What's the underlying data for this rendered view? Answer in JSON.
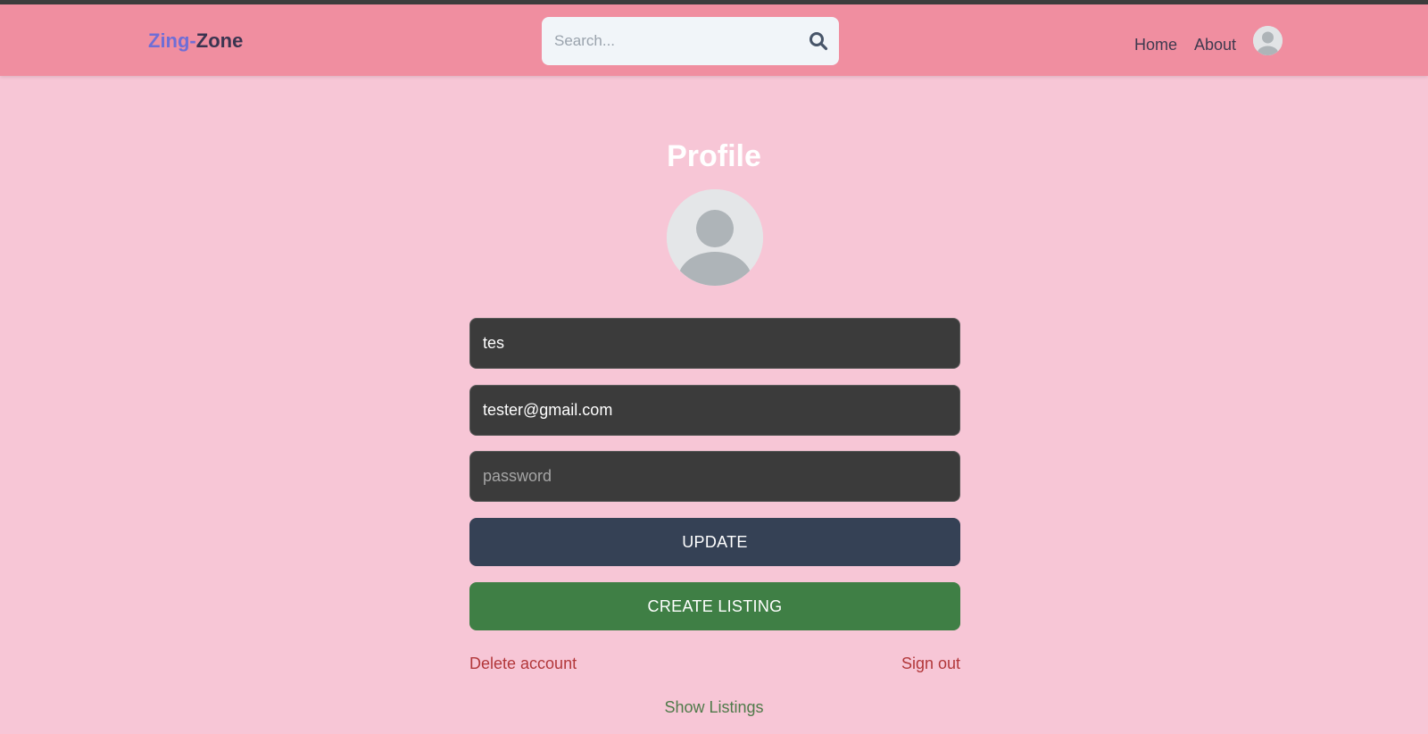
{
  "header": {
    "logo_part1": "Zing-",
    "logo_part2": "Zone",
    "search_placeholder": "Search...",
    "search_icon": "search-icon",
    "nav": {
      "home": "Home",
      "about": "About"
    },
    "avatar_icon": "user-avatar-icon"
  },
  "profile": {
    "title": "Profile",
    "avatar_icon": "user-avatar-icon",
    "username_value": "tes",
    "email_value": "tester@gmail.com",
    "password_placeholder": "password",
    "update_label": "UPDATE",
    "create_listing_label": "CREATE LISTING",
    "delete_account_label": "Delete account",
    "sign_out_label": "Sign out",
    "show_listings_label": "Show Listings"
  },
  "colors": {
    "page_bg": "#f7c6d6",
    "header_bg": "#f08ea0",
    "input_bg": "#3b3b3b",
    "update_bg": "#354155",
    "create_bg": "#3f7f45",
    "danger_text": "#b2373a",
    "show_listings_text": "#4f7a4a",
    "logo_accent": "#6f6ed6"
  }
}
